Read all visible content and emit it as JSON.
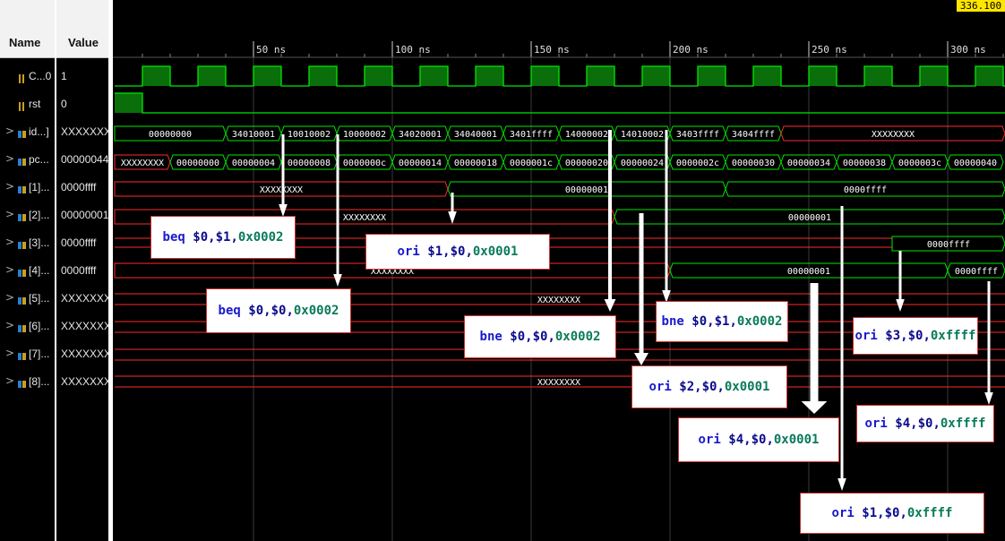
{
  "header": {
    "name_label": "Name",
    "value_label": "Value"
  },
  "cursor_time": "336.100",
  "time_markers": [
    "50 ns",
    "100 ns",
    "150 ns",
    "200 ns",
    "250 ns",
    "300 ns"
  ],
  "signals": [
    {
      "expander": "",
      "icon": "bit",
      "name": "C...0",
      "value": "1"
    },
    {
      "expander": "",
      "icon": "bit",
      "name": "rst",
      "value": "0"
    },
    {
      "expander": ">",
      "icon": "bus",
      "name": "id...]",
      "value": "XXXXXXXX"
    },
    {
      "expander": ">",
      "icon": "bus",
      "name": "pc...",
      "value": "00000044"
    },
    {
      "expander": ">",
      "icon": "bus",
      "name": "[1]...",
      "value": "0000ffff"
    },
    {
      "expander": ">",
      "icon": "bus",
      "name": "[2]...",
      "value": "00000001"
    },
    {
      "expander": ">",
      "icon": "bus",
      "name": "[3]...",
      "value": "0000ffff"
    },
    {
      "expander": ">",
      "icon": "bus",
      "name": "[4]...",
      "value": "0000ffff"
    },
    {
      "expander": ">",
      "icon": "bus",
      "name": "[5]...",
      "value": "XXXXXXXX"
    },
    {
      "expander": ">",
      "icon": "bus",
      "name": "[6]...",
      "value": "XXXXXXXX"
    },
    {
      "expander": ">",
      "icon": "bus",
      "name": "[7]...",
      "value": "XXXXXXXX"
    },
    {
      "expander": ">",
      "icon": "bus",
      "name": "[8]...",
      "value": "XXXXXXXX"
    }
  ],
  "buses": {
    "id": [
      "00000000",
      "34010001",
      "10010002",
      "10000002",
      "34020001",
      "34040001",
      "3401ffff",
      "14000002",
      "14010002",
      "3403ffff",
      "3404ffff",
      "XXXXXXXX"
    ],
    "pc": [
      "XXXXXXXX",
      "00000000",
      "00000004",
      "00000008",
      "0000000c",
      "00000014",
      "00000018",
      "0000001c",
      "00000020",
      "00000024",
      "0000002c",
      "00000030",
      "00000034",
      "00000038",
      "0000003c",
      "00000040"
    ],
    "r1": [
      "XXXXXXXX",
      "00000001",
      "0000ffff"
    ],
    "r2": [
      "XXXXXXXX",
      "00000001"
    ],
    "r3": [
      "0000ffff"
    ],
    "r4": [
      "XXXXXXXX",
      "00000001",
      "0000ffff"
    ],
    "r5": "XXXXXXXX",
    "r6": "XXXXXXXX",
    "r7": "XXXXXXXX",
    "r8": "XXXXXXXX"
  },
  "annotations": [
    {
      "op": "beq",
      "args": [
        "$0",
        "$1",
        "0x0002"
      ]
    },
    {
      "op": "beq",
      "args": [
        "$0",
        "$0",
        "0x0002"
      ]
    },
    {
      "op": "ori",
      "args": [
        "$1",
        "$0",
        "0x0001"
      ]
    },
    {
      "op": "bne",
      "args": [
        "$0",
        "$0",
        "0x0002"
      ]
    },
    {
      "op": "bne",
      "args": [
        "$0",
        "$1",
        "0x0002"
      ]
    },
    {
      "op": "ori",
      "args": [
        "$2",
        "$0",
        "0x0001"
      ]
    },
    {
      "op": "ori",
      "args": [
        "$4",
        "$0",
        "0x0001"
      ]
    },
    {
      "op": "ori",
      "args": [
        "$3",
        "$0",
        "0xffff"
      ]
    },
    {
      "op": "ori",
      "args": [
        "$4",
        "$0",
        "0xffff"
      ]
    },
    {
      "op": "ori",
      "args": [
        "$1",
        "$0",
        "0xffff"
      ]
    }
  ],
  "colors": {
    "wave_high": "#00e600",
    "wave_fill": "#0a6e0a",
    "undefined": "#ff2a2a",
    "bus_text": "#ffffff",
    "gridline": "#3a3a3a"
  }
}
